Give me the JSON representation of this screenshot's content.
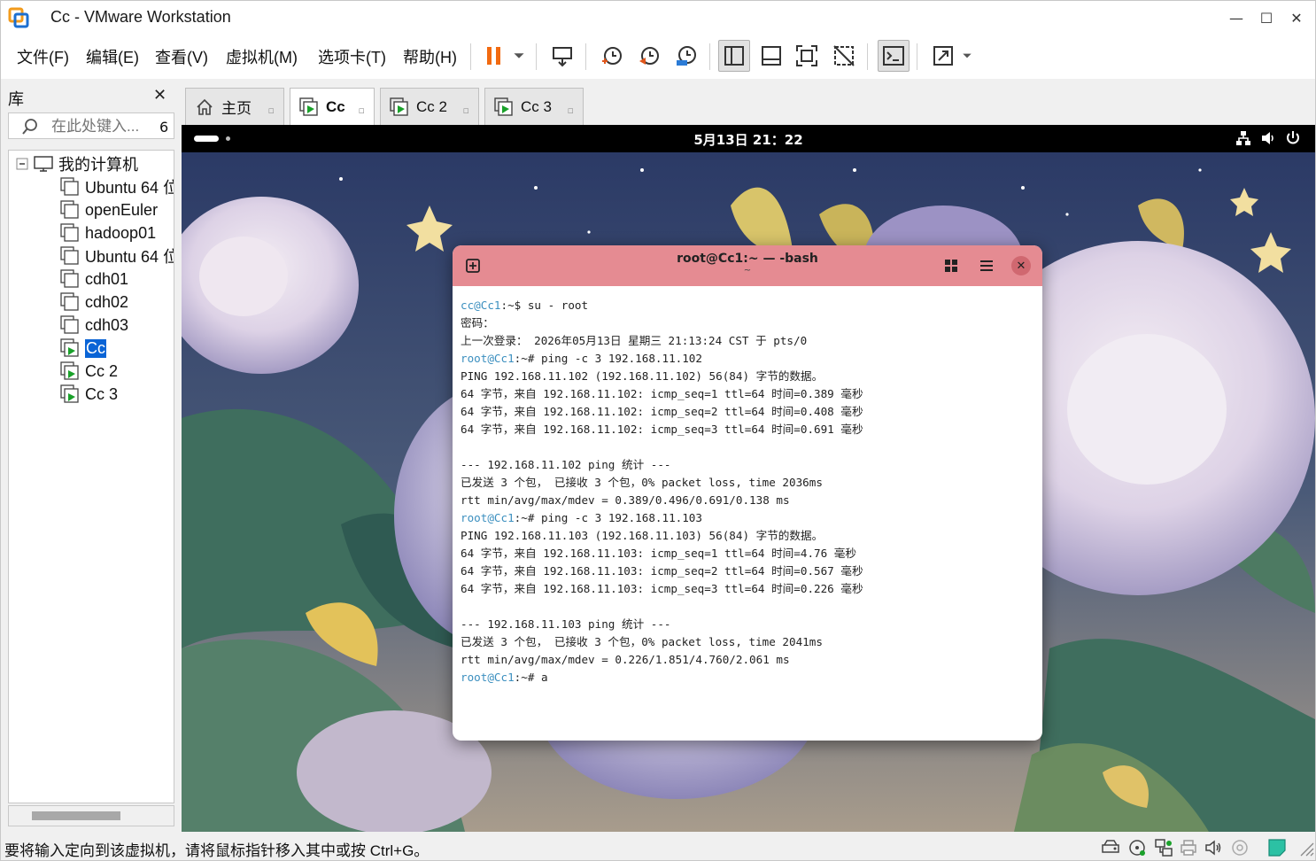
{
  "window": {
    "title": "Cc - VMware Workstation",
    "minimize": "—",
    "maximize": "☐",
    "close": "✕"
  },
  "menu": [
    {
      "label": "文件(F)"
    },
    {
      "label": "编辑(E)"
    },
    {
      "label": "查看(V)"
    },
    {
      "label": "虚拟机(M)"
    },
    {
      "label": "选项卡(T)"
    },
    {
      "label": "帮助(H)"
    }
  ],
  "toolbar": {
    "icons": [
      "pause-icon",
      "dropdown-icon",
      "send-keys-icon",
      "snapshot-take-icon",
      "snapshot-revert-icon",
      "snapshot-manager-icon",
      "library-view-icon",
      "thumbnail-view-icon",
      "fullscreen-icon",
      "unity-icon",
      "console-icon",
      "stretch-icon"
    ]
  },
  "library": {
    "title": "库",
    "close": "✕",
    "search_placeholder": "在此处键入...",
    "search_count": "6",
    "root": "我的计算机",
    "items": [
      {
        "label": "Ubuntu 64 位",
        "running": false
      },
      {
        "label": "openEuler",
        "running": false
      },
      {
        "label": "hadoop01",
        "running": false
      },
      {
        "label": "Ubuntu 64 位",
        "running": false
      },
      {
        "label": "cdh01",
        "running": false
      },
      {
        "label": "cdh02",
        "running": false
      },
      {
        "label": "cdh03",
        "running": false
      },
      {
        "label": "Cc",
        "running": true,
        "selected": true
      },
      {
        "label": "Cc 2",
        "running": true
      },
      {
        "label": "Cc 3",
        "running": true
      }
    ]
  },
  "tabs": [
    {
      "label": "主页",
      "icon": "home-icon"
    },
    {
      "label": "Cc",
      "icon": "vm-running-icon",
      "active": true
    },
    {
      "label": "Cc 2",
      "icon": "vm-running-icon"
    },
    {
      "label": "Cc 3",
      "icon": "vm-running-icon"
    }
  ],
  "guest": {
    "clock": "5月13日  21：22",
    "tray": [
      "network-icon",
      "volume-icon",
      "power-icon"
    ],
    "terminal": {
      "title": "root@Cc1:~ — -bash",
      "subtitle": "~",
      "lines": [
        {
          "prompt": "cc@Cc1",
          "path": ":~$",
          "text": " su - root"
        },
        {
          "text": "密码："
        },
        {
          "text": "上一次登录： 2026年05月13日 星期三 21:13:24 CST 于 pts/0"
        },
        {
          "prompt": "root@Cc1",
          "path": ":~#",
          "text": " ping -c 3 192.168.11.102"
        },
        {
          "text": "PING 192.168.11.102 (192.168.11.102) 56(84) 字节的数据。"
        },
        {
          "text": "64 字节，来自 192.168.11.102: icmp_seq=1 ttl=64 时间=0.389 毫秒"
        },
        {
          "text": "64 字节，来自 192.168.11.102: icmp_seq=2 ttl=64 时间=0.408 毫秒"
        },
        {
          "text": "64 字节，来自 192.168.11.102: icmp_seq=3 ttl=64 时间=0.691 毫秒"
        },
        {
          "text": ""
        },
        {
          "text": "--- 192.168.11.102 ping 统计 ---"
        },
        {
          "text": "已发送 3 个包， 已接收 3 个包，0% packet loss, time 2036ms"
        },
        {
          "text": "rtt min/avg/max/mdev = 0.389/0.496/0.691/0.138 ms"
        },
        {
          "prompt": "root@Cc1",
          "path": ":~#",
          "text": " ping -c 3 192.168.11.103"
        },
        {
          "text": "PING 192.168.11.103 (192.168.11.103) 56(84) 字节的数据。"
        },
        {
          "text": "64 字节，来自 192.168.11.103: icmp_seq=1 ttl=64 时间=4.76 毫秒"
        },
        {
          "text": "64 字节，来自 192.168.11.103: icmp_seq=2 ttl=64 时间=0.567 毫秒"
        },
        {
          "text": "64 字节，来自 192.168.11.103: icmp_seq=3 ttl=64 时间=0.226 毫秒"
        },
        {
          "text": ""
        },
        {
          "text": "--- 192.168.11.103 ping 统计 ---"
        },
        {
          "text": "已发送 3 个包， 已接收 3 个包，0% packet loss, time 2041ms"
        },
        {
          "text": "rtt min/avg/max/mdev = 0.226/1.851/4.760/2.061 ms"
        },
        {
          "prompt": "root@Cc1",
          "path": ":~#",
          "text": " a"
        }
      ]
    }
  },
  "status": {
    "text": "要将输入定向到该虚拟机，请将鼠标指针移入其中或按 Ctrl+G。",
    "icons": [
      "hdd-icon",
      "cdrom-icon",
      "network-adapter-icon",
      "printer-icon",
      "sound-icon",
      "usb-icon",
      "message-icon"
    ]
  }
}
